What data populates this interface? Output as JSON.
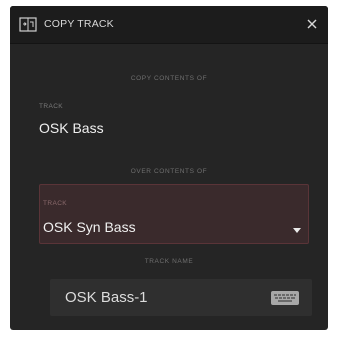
{
  "dialog": {
    "title": "COPY TRACK",
    "title_icon": "copy-track-icon",
    "close_icon": "close-icon"
  },
  "source": {
    "section_label": "COPY CONTENTS OF",
    "field_caption": "TRACK",
    "value": "OSK Bass"
  },
  "target": {
    "section_label": "OVER CONTENTS OF",
    "field_caption": "TRACK",
    "value": "OSK Syn Bass",
    "dropdown_icon": "dropdown-arrow-icon"
  },
  "track_name": {
    "section_label": "TRACK NAME",
    "value": "OSK Bass-1",
    "keyboard_icon": "keyboard-icon"
  },
  "colors": {
    "dialog_bg": "#252525",
    "titlebar_bg": "#1c1c1c",
    "target_highlight": "#3a2a2c",
    "text_primary": "#f0f0f0"
  }
}
